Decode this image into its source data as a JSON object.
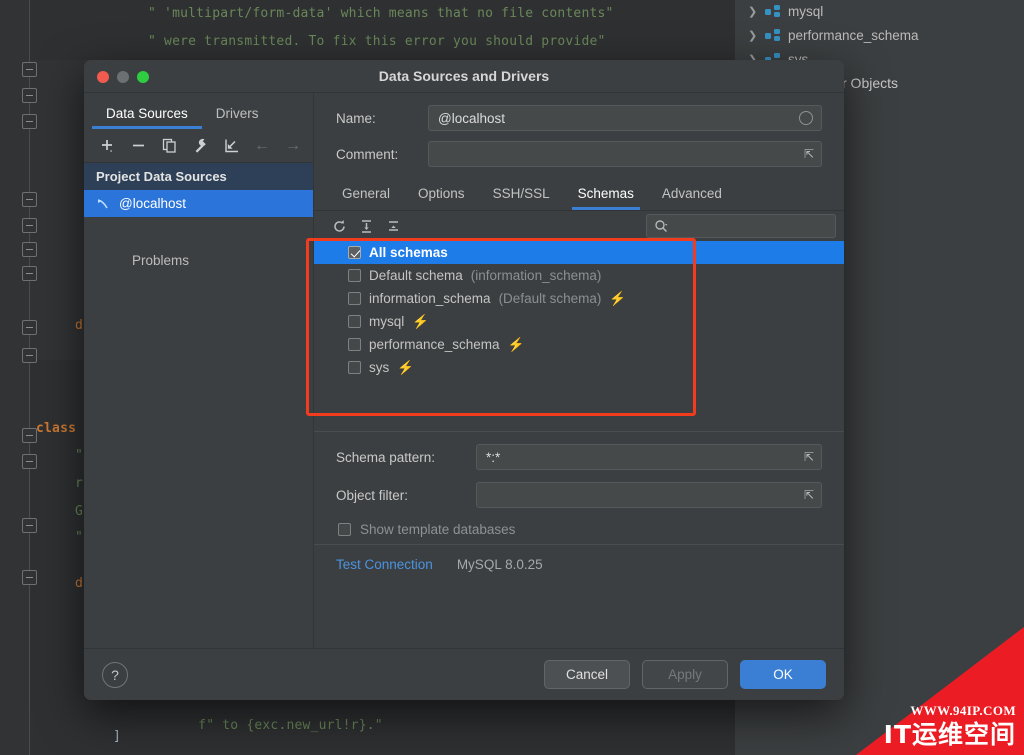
{
  "editor": {
    "code_lines": [
      {
        "text": "\" 'multipart/form-data' which means that no file contents\""
      },
      {
        "text": "\" were transmitted. To fix this error you should provide\""
      },
      {
        "text": "f\" to {exc.new_url!r}.\""
      },
      {
        "text": "]"
      }
    ],
    "fragment_class": "class",
    "fragment_d": "d"
  },
  "db_tree": {
    "items": [
      {
        "label": "mysql",
        "icon": "schema-icon"
      },
      {
        "label": "performance_schema",
        "icon": "schema-icon"
      },
      {
        "label": "sys",
        "icon": "schema-icon"
      }
    ],
    "objects_label": "r Objects"
  },
  "dialog": {
    "title": "Data Sources and Drivers",
    "window_controls": [
      "close",
      "minimize",
      "zoom"
    ],
    "left": {
      "tabs": [
        {
          "label": "Data Sources",
          "active": true
        },
        {
          "label": "Drivers",
          "active": false
        }
      ],
      "toolbar": [
        {
          "name": "add-icon",
          "glyph": "+"
        },
        {
          "name": "remove-icon",
          "glyph": "−"
        },
        {
          "name": "copy-icon",
          "glyph": "copy"
        },
        {
          "name": "wrench-icon",
          "glyph": "wrench"
        },
        {
          "name": "import-icon",
          "glyph": "import"
        },
        {
          "name": "arrow-left-icon",
          "glyph": "←"
        },
        {
          "name": "arrow-right-icon",
          "glyph": "→"
        }
      ],
      "group_header": "Project Data Sources",
      "data_source": "@localhost",
      "problems": "Problems"
    },
    "form": {
      "name_label": "Name:",
      "name_value": "@localhost",
      "comment_label": "Comment:",
      "comment_value": ""
    },
    "config_tabs": [
      {
        "label": "General",
        "active": false
      },
      {
        "label": "Options",
        "active": false
      },
      {
        "label": "SSH/SSL",
        "active": false
      },
      {
        "label": "Schemas",
        "active": true
      },
      {
        "label": "Advanced",
        "active": false
      }
    ],
    "list_toolbar": [
      {
        "name": "refresh-icon"
      },
      {
        "name": "expand-all-icon"
      },
      {
        "name": "collapse-all-icon"
      }
    ],
    "search_placeholder": "",
    "schemas": [
      {
        "label": "All schemas",
        "note": "",
        "checked": true,
        "selected": true,
        "bolt": false
      },
      {
        "label": "Default schema",
        "note": "(information_schema)",
        "checked": false,
        "selected": false,
        "bolt": false
      },
      {
        "label": "information_schema",
        "note": "(Default schema)",
        "checked": false,
        "selected": false,
        "bolt": true
      },
      {
        "label": "mysql",
        "note": "",
        "checked": false,
        "selected": false,
        "bolt": true
      },
      {
        "label": "performance_schema",
        "note": "",
        "checked": false,
        "selected": false,
        "bolt": true
      },
      {
        "label": "sys",
        "note": "",
        "checked": false,
        "selected": false,
        "bolt": true
      }
    ],
    "schema_pattern_label": "Schema pattern:",
    "schema_pattern_value": "*:*",
    "object_filter_label": "Object filter:",
    "object_filter_value": "",
    "show_template_label": "Show template databases",
    "show_template_checked": false,
    "test_connection_label": "Test Connection",
    "driver_version": "MySQL 8.0.25",
    "footer": {
      "help_label": "?",
      "cancel_label": "Cancel",
      "apply_label": "Apply",
      "ok_label": "OK"
    }
  },
  "annotation": {
    "color": "#f23c1d"
  },
  "watermark": {
    "url": "WWW.94IP.COM",
    "text": "IT运维空间",
    "color": "#ec1c24"
  }
}
